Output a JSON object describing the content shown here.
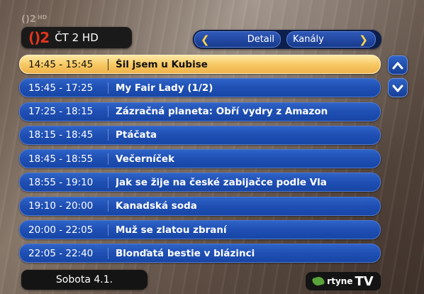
{
  "channel": {
    "logo": "()2",
    "name": "ČT 2 HD",
    "corner_logo": "()2",
    "corner_hd": "HD"
  },
  "nav": {
    "detail_label": "Detail",
    "channels_label": "Kanály"
  },
  "programs": [
    {
      "time": "14:45 - 15:45",
      "title": "Šil jsem u Kubise",
      "selected": true
    },
    {
      "time": "15:45 - 17:25",
      "title": "My Fair Lady (1/2)"
    },
    {
      "time": "17:25 - 18:15",
      "title": "Zázračná planeta: Obří vydry z Amazon"
    },
    {
      "time": "18:15 - 18:45",
      "title": "Ptáčata"
    },
    {
      "time": "18:45 - 18:55",
      "title": "Večerníček"
    },
    {
      "time": "18:55 - 19:10",
      "title": "Jak se žije na české zabijačce podle Vla"
    },
    {
      "time": "19:10 - 20:00",
      "title": "Kanadská soda"
    },
    {
      "time": "20:00 - 22:05",
      "title": "Muž se zlatou zbraní"
    },
    {
      "time": "22:05 - 22:40",
      "title": "Blonďatá bestie v blázinci"
    }
  ],
  "footer": {
    "date": "Sobota 4.1.",
    "brand_small": "rtyne",
    "brand_tv": "TV"
  },
  "colors": {
    "row_blue": "#1f4fb3",
    "row_selected": "#f7c964",
    "accent_yellow": "#ffd24a"
  }
}
